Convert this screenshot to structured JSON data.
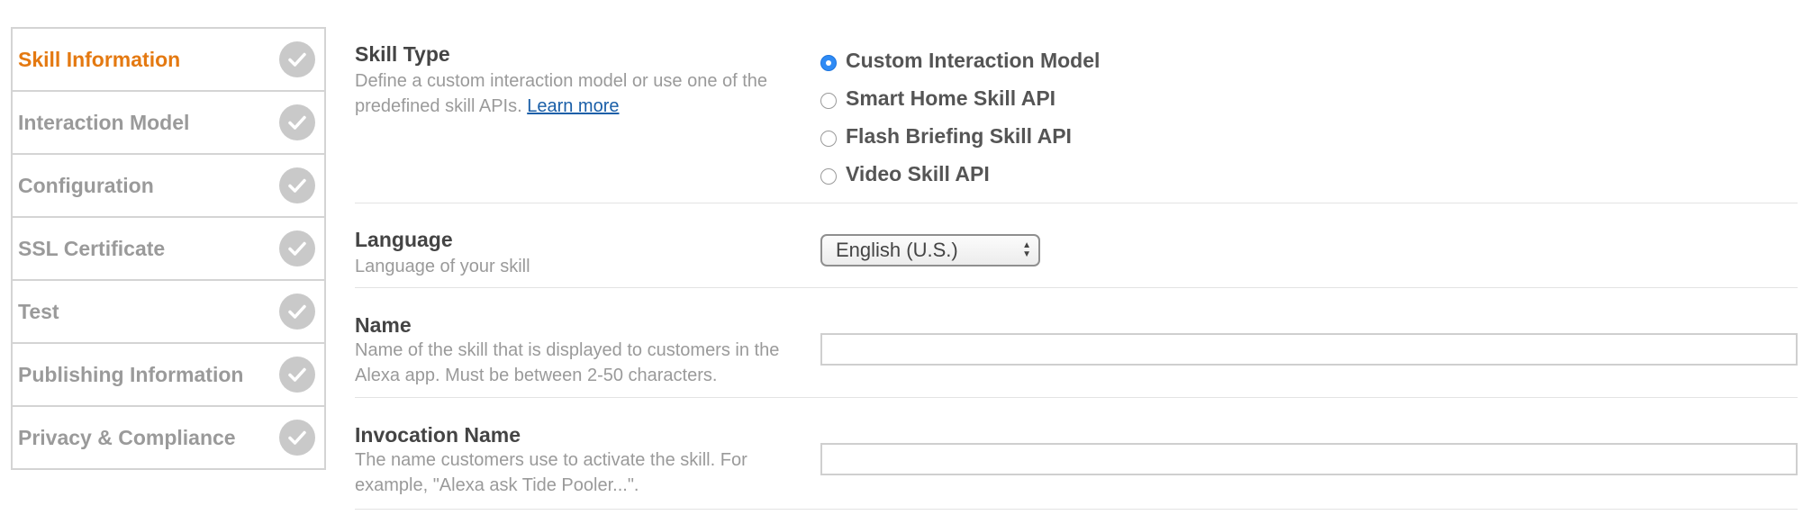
{
  "sidebar": {
    "items": [
      {
        "label": "Skill Information",
        "active": true
      },
      {
        "label": "Interaction Model",
        "active": false
      },
      {
        "label": "Configuration",
        "active": false
      },
      {
        "label": "SSL Certificate",
        "active": false
      },
      {
        "label": "Test",
        "active": false
      },
      {
        "label": "Publishing Information",
        "active": false
      },
      {
        "label": "Privacy & Compliance",
        "active": false
      }
    ],
    "check_icon": "checkmark-circle-icon",
    "active_color": "#e47911",
    "inactive_color": "#9a9a9a"
  },
  "skill_type": {
    "title": "Skill Type",
    "description": "Define a custom interaction model or use one of the predefined skill APIs.",
    "link": "Learn more",
    "options": [
      {
        "label": "Custom Interaction Model",
        "selected": true
      },
      {
        "label": "Smart Home Skill API",
        "selected": false
      },
      {
        "label": "Flash Briefing Skill API",
        "selected": false
      },
      {
        "label": "Video Skill API",
        "selected": false
      }
    ]
  },
  "language": {
    "title": "Language",
    "description": "Language of your skill",
    "selected": "English (U.S.)"
  },
  "name": {
    "title": "Name",
    "description": "Name of the skill that is displayed to customers in the Alexa app. Must be between 2-50 characters.",
    "value": ""
  },
  "invocation_name": {
    "title": "Invocation Name",
    "description": "The name customers use to activate the skill. For example, \"Alexa ask Tide Pooler...\".",
    "value": ""
  }
}
